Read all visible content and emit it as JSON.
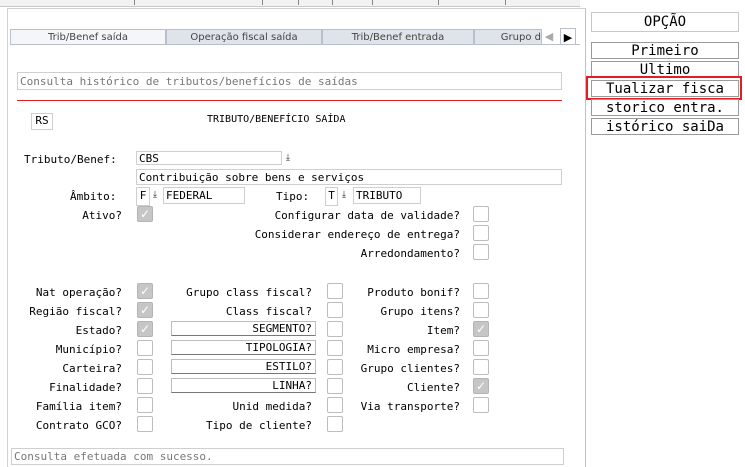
{
  "tabs": [
    {
      "label": "Trib/Benef saída",
      "active": true
    },
    {
      "label": "Operação fiscal saída",
      "active": false
    },
    {
      "label": "Trib/Benef entrada",
      "active": false
    },
    {
      "label": "Grupo d",
      "active": false
    }
  ],
  "header": {
    "description": "Consulta histórico de tributos/benefícios de saídas",
    "code": "RS",
    "title": "TRIBUTO/BENEFÍCIO SAÍDA"
  },
  "form": {
    "tributo_label": "Tributo/Benef:",
    "tributo_value": "CBS",
    "tributo_desc": "Contribuição sobre bens e serviços",
    "ambito_label": "Âmbito:",
    "ambito_code": "F",
    "ambito_value": "FEDERAL",
    "tipo_label": "Tipo:",
    "tipo_code": "T",
    "tipo_value": "TRIBUTO",
    "ativo_label": "Ativo?",
    "config_label": "Configurar data de validade?",
    "endereco_label": "Considerar endereço de entrega?",
    "arred_label": "Arredondamento?"
  },
  "grid": {
    "col1": [
      {
        "label": "Nat operação?",
        "checked": true
      },
      {
        "label": "Região fiscal?",
        "checked": true
      },
      {
        "label": "Estado?",
        "checked": true
      },
      {
        "label": "Município?",
        "checked": false
      },
      {
        "label": "Carteira?",
        "checked": false
      },
      {
        "label": "Finalidade?",
        "checked": false
      },
      {
        "label": "Família item?",
        "checked": false
      },
      {
        "label": "Contrato GCO?",
        "checked": false
      }
    ],
    "col2": [
      {
        "label": "Grupo class fiscal?",
        "checked": false
      },
      {
        "label": "Class fiscal?",
        "checked": false
      },
      {
        "label": "SEGMENTO?",
        "checked": false
      },
      {
        "label": "TIPOLOGIA?",
        "checked": false
      },
      {
        "label": "ESTILO?",
        "checked": false
      },
      {
        "label": "LINHA?",
        "checked": false
      },
      {
        "label": "Unid medida?",
        "checked": false
      },
      {
        "label": "Tipo de cliente?",
        "checked": false
      }
    ],
    "col3": [
      {
        "label": "Produto bonif?",
        "checked": false
      },
      {
        "label": "Grupo itens?",
        "checked": false
      },
      {
        "label": "Item?",
        "checked": true
      },
      {
        "label": "Micro empresa?",
        "checked": false
      },
      {
        "label": "Grupo clientes?",
        "checked": false
      },
      {
        "label": "Cliente?",
        "checked": true
      },
      {
        "label": "Via transporte?",
        "checked": false
      }
    ]
  },
  "status": "Consulta efetuada com sucesso.",
  "options": {
    "title": "OPÇÃO",
    "items": [
      "Primeiro",
      "Ultimo",
      "Tualizar fisca",
      "storico entra.",
      "istórico saiDa"
    ],
    "highlight_color": "#e02020"
  }
}
